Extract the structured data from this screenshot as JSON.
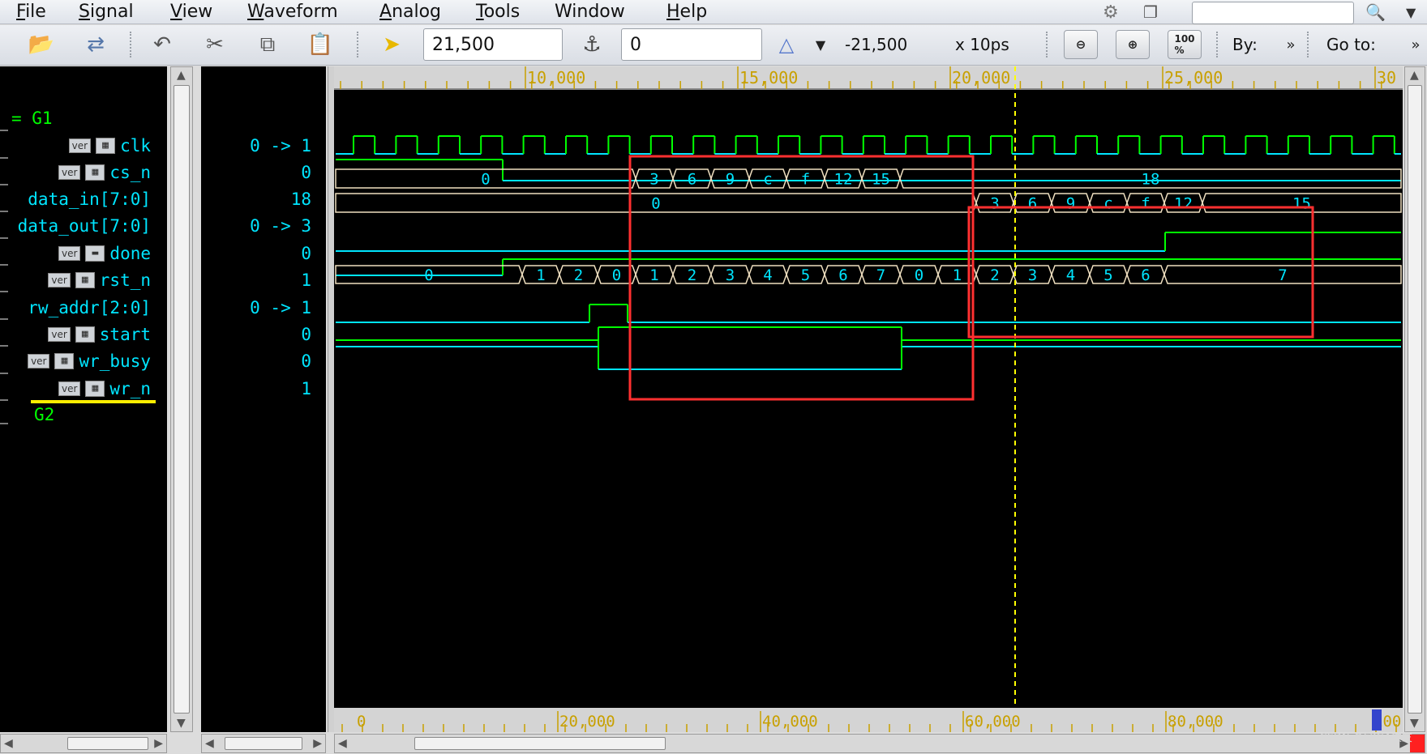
{
  "menubar": {
    "items": [
      {
        "first": "F",
        "rest": "ile"
      },
      {
        "first": "S",
        "rest": "ignal"
      },
      {
        "first": "V",
        "rest": "iew"
      },
      {
        "first": "W",
        "rest": "aveform"
      },
      {
        "first": "A",
        "rest": "nalog"
      },
      {
        "first": "T",
        "rest": "ools"
      },
      {
        "first": "W",
        "rest": "indow"
      },
      {
        "first": "H",
        "rest": "elp"
      }
    ],
    "search_value": ""
  },
  "toolbar": {
    "cursor_time": "21,500",
    "marker_time": "0",
    "delta": "-21,500",
    "time_unit": "x 10ps",
    "by_label": "By:",
    "goto_label": "Go to:",
    "zoom_100": "100\n%"
  },
  "signals": {
    "group1_label": "= G1",
    "group2_label": "G2",
    "items": [
      {
        "name": "clk",
        "badge": "ver",
        "value": "0 -> 1"
      },
      {
        "name": "cs_n",
        "badge": "ver",
        "value": "0"
      },
      {
        "name": "data_in[7:0]",
        "badge": "",
        "value": "18"
      },
      {
        "name": "data_out[7:0]",
        "badge": "",
        "value": "0 -> 3"
      },
      {
        "name": "done",
        "badge": "ver",
        "value": "0"
      },
      {
        "name": "rst_n",
        "badge": "ver",
        "value": "1"
      },
      {
        "name": "rw_addr[2:0]",
        "badge": "",
        "value": "0 -> 1"
      },
      {
        "name": "start",
        "badge": "ver",
        "value": "0"
      },
      {
        "name": "wr_busy",
        "badge": "ver",
        "value": "0"
      },
      {
        "name": "wr_n",
        "badge": "ver",
        "value": "1"
      }
    ]
  },
  "timeline": {
    "top_labels": [
      "10,000",
      "15,000",
      "20,000",
      "25,000",
      "30"
    ],
    "bottom_labels": [
      "0",
      "20,000",
      "40,000",
      "60,000",
      "80,000",
      "100"
    ]
  },
  "waveforms": {
    "data_in": {
      "segments": [
        "0",
        "3",
        "6",
        "9",
        "c",
        "f",
        "12",
        "15",
        "18"
      ]
    },
    "data_out": {
      "segments": [
        "0",
        "3",
        "6",
        "9",
        "c",
        "f",
        "12",
        "15"
      ]
    },
    "rw_addr": {
      "segments": [
        "0",
        "1",
        "2",
        "0",
        "1",
        "2",
        "3",
        "4",
        "5",
        "6",
        "7",
        "0",
        "1",
        "2",
        "3",
        "4",
        "5",
        "6",
        "7"
      ]
    }
  },
  "colors": {
    "wave_high": "#00ff00",
    "wave_low": "#00e5ff",
    "bus": "#f0e0c0",
    "cursor": "#ffff00",
    "highlight_box": "#ff3030"
  },
  "watermark": "CSDN @FPGA技友"
}
